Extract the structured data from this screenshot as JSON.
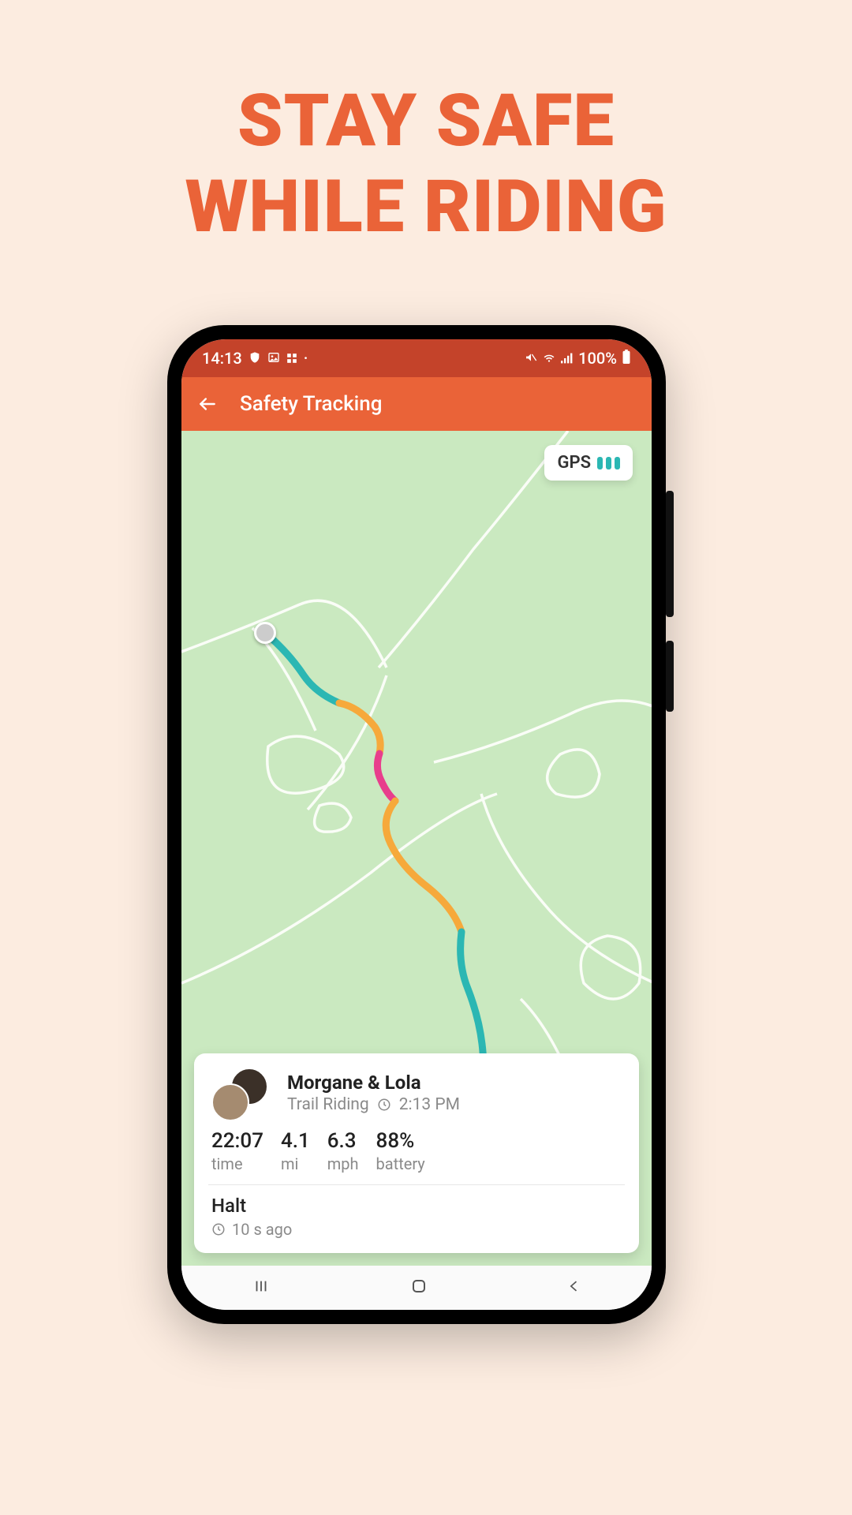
{
  "promo": {
    "headline_line1": "STAY SAFE",
    "headline_line2": "WHILE RIDING"
  },
  "colors": {
    "accent": "#ea6338",
    "statusbar": "#c4432a",
    "map_bg": "#cae9c0",
    "gps_bar": "#2bb7b3"
  },
  "statusbar": {
    "time": "14:13",
    "battery_text": "100%"
  },
  "appbar": {
    "title": "Safety Tracking"
  },
  "gps": {
    "label": "GPS"
  },
  "card": {
    "name": "Morgane & Lola",
    "activity": "Trail Riding",
    "start_time": "2:13 PM",
    "stats": [
      {
        "value": "22:07",
        "label": "time"
      },
      {
        "value": "4.1",
        "label": "mi"
      },
      {
        "value": "6.3",
        "label": "mph"
      },
      {
        "value": "88%",
        "label": "battery"
      }
    ],
    "status_title": "Halt",
    "status_time": "10 s ago"
  }
}
